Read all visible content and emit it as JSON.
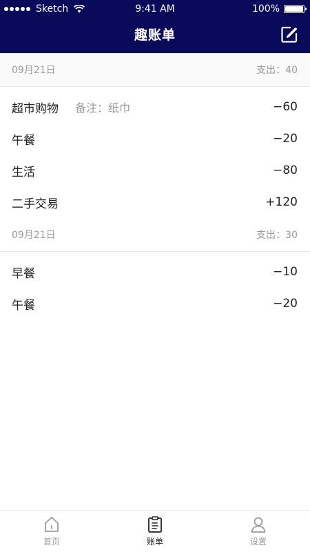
{
  "status_bar": {
    "carrier": "Sketch",
    "time": "9:41 AM",
    "battery": "100%"
  },
  "header": {
    "title": "趣账单"
  },
  "sections": [
    {
      "date": "09月21日",
      "total": "支出：40",
      "rows": [
        {
          "name": "超市购物",
          "note": "备注：纸巾",
          "amount": "−60"
        },
        {
          "name": "午餐",
          "note": "",
          "amount": "−20"
        },
        {
          "name": "生活",
          "note": "",
          "amount": "−80"
        },
        {
          "name": "二手交易",
          "note": "",
          "amount": "+120"
        }
      ]
    },
    {
      "date": "09月21日",
      "total": "支出：30",
      "rows": [
        {
          "name": "早餐",
          "note": "",
          "amount": "−10"
        },
        {
          "name": "午餐",
          "note": "",
          "amount": "−20"
        }
      ]
    }
  ],
  "tabbar": {
    "items": [
      {
        "label": "首页",
        "icon": "home-icon"
      },
      {
        "label": "账单",
        "icon": "bill-icon"
      },
      {
        "label": "设置",
        "icon": "user-icon"
      }
    ],
    "active": "账单"
  },
  "colors": {
    "header_bg": "#0a0a5a",
    "text_primary": "#222222",
    "text_secondary": "#9a9a9a"
  }
}
